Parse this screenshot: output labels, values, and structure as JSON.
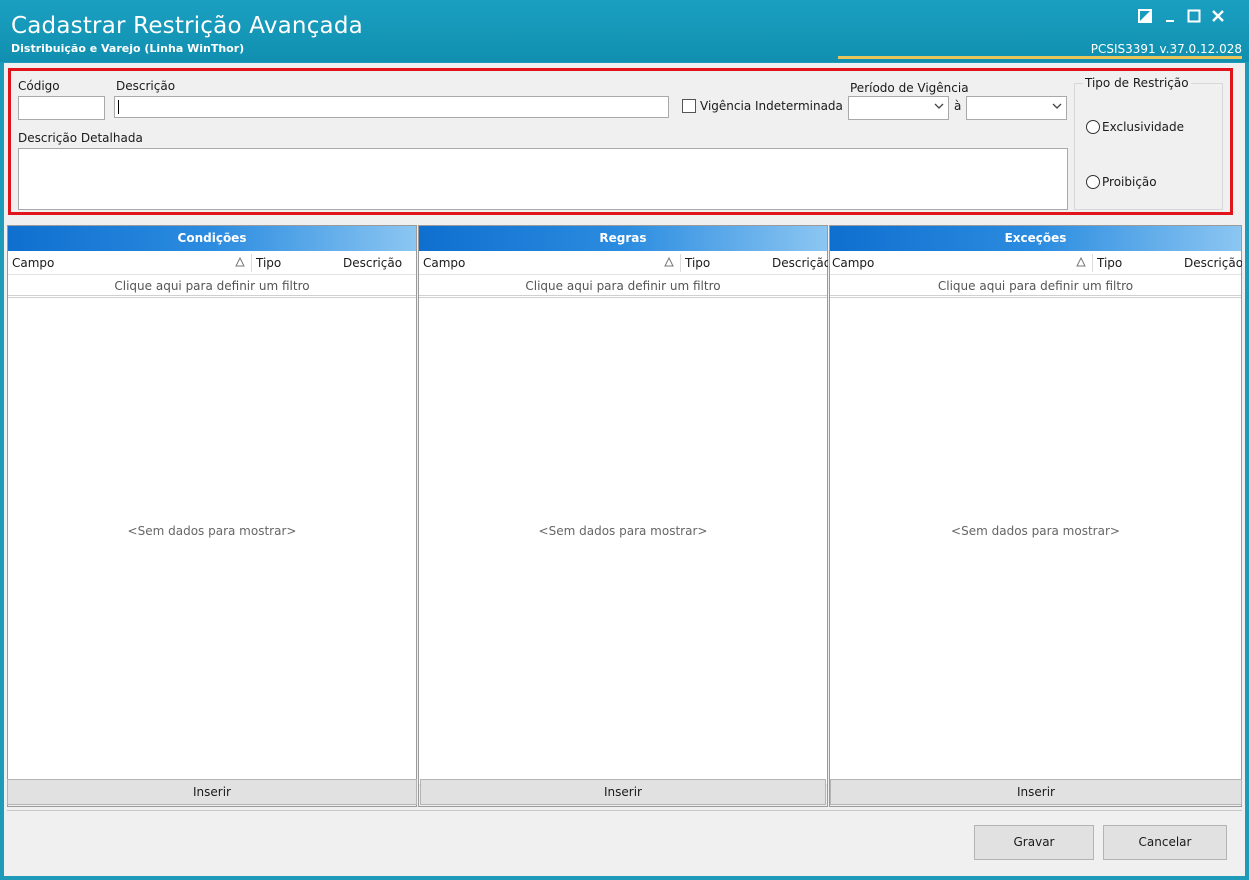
{
  "window": {
    "title": "Cadastrar Restrição Avançada",
    "subtitle": "Distribuição e Varejo (Linha WinThor)",
    "version": "PCSIS3391  v.37.0.12.028",
    "colors": {
      "titlebar": "#1597b8",
      "accent": "#e8c45a",
      "highlight_border": "#e0141b",
      "grid_header": "#2b8ce0"
    }
  },
  "form": {
    "codigo_label": "Código",
    "codigo_value": "",
    "descricao_label": "Descrição",
    "descricao_value": "",
    "vigencia_indeterminada_label": "Vigência Indeterminada",
    "vigencia_indeterminada_checked": false,
    "periodo_label": "Período de Vigência",
    "periodo_inicio": "",
    "periodo_separator": "à",
    "periodo_fim": "",
    "descricao_detalhada_label": "Descrição Detalhada",
    "descricao_detalhada_value": "",
    "tipo_restricao": {
      "label": "Tipo de Restrição",
      "options": [
        "Exclusividade",
        "Proibição"
      ],
      "selected": null
    }
  },
  "grids": [
    {
      "title": "Condições",
      "columns": [
        "Campo",
        "Tipo",
        "Descrição"
      ],
      "filter_text": "Clique aqui para definir um filtro",
      "empty_text": "<Sem dados para mostrar>",
      "insert_label": "Inserir"
    },
    {
      "title": "Regras",
      "columns": [
        "Campo",
        "Tipo",
        "Descrição"
      ],
      "filter_text": "Clique aqui para definir um filtro",
      "empty_text": "<Sem dados para mostrar>",
      "insert_label": "Inserir"
    },
    {
      "title": "Exceções",
      "columns": [
        "Campo",
        "Tipo",
        "Descrição"
      ],
      "filter_text": "Clique aqui para definir um filtro",
      "empty_text": "<Sem dados para mostrar>",
      "insert_label": "Inserir"
    }
  ],
  "footer": {
    "save_label": "Gravar",
    "cancel_label": "Cancelar"
  },
  "icons": [
    "restore-icon",
    "minimize-icon",
    "maximize-icon",
    "close-icon",
    "sort-ascending-icon",
    "chevron-down-icon",
    "scroll-left-icon",
    "scroll-right-icon"
  ]
}
